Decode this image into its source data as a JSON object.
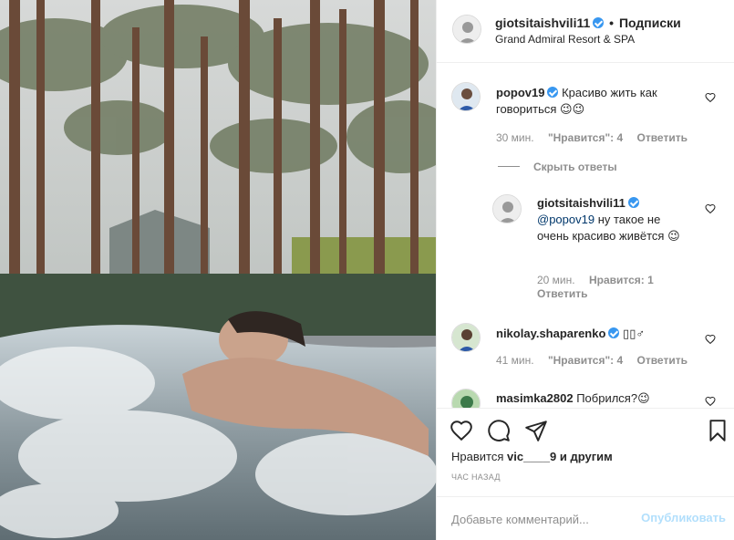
{
  "post": {
    "username": "giotsitaishvili11",
    "dot": "•",
    "follow_label": "Подписки",
    "location": "Grand Admiral Resort & SPA"
  },
  "comments": [
    {
      "username": "popov19",
      "text": "Красиво жить как говориться 😉😉",
      "time": "30 мин.",
      "likes": "\"Нравится\": 4",
      "reply_label": "Ответить"
    },
    {
      "username": "giotsitaishvili11",
      "mention": "@popov19",
      "text": " ну такое не очень красиво живётся 😉",
      "time": "20 мин.",
      "likes": "Нравится: 1",
      "reply_label": "Ответить"
    },
    {
      "username": "nikolay.shaparenko",
      "text": "▯▯♂",
      "time": "41 мин.",
      "likes": "\"Нравится\": 4",
      "reply_label": "Ответить"
    },
    {
      "username": "masimka2802",
      "text": "Побрился?😉"
    }
  ],
  "hide_replies": "Скрыть ответы",
  "likes_summary": {
    "prefix": "Нравится",
    "user": "vic____9",
    "suffix": "и другим"
  },
  "timestamp": "ЧАС НАЗАД",
  "add_comment": {
    "placeholder": "Добавьте комментарий...",
    "post_label": "Опубликовать"
  },
  "colors": {
    "verified": "#3897f0",
    "post_disabled": "#b2dffc",
    "muted": "#8e8e8e"
  },
  "icons": [
    "heart-icon",
    "comment-icon",
    "share-icon",
    "bookmark-icon",
    "verified-icon"
  ]
}
